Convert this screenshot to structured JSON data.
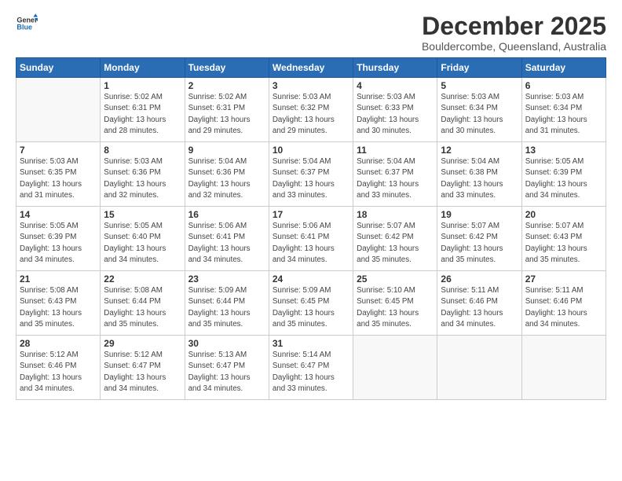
{
  "header": {
    "logo_line1": "General",
    "logo_line2": "Blue",
    "month_title": "December 2025",
    "location": "Bouldercombe, Queensland, Australia"
  },
  "days_of_week": [
    "Sunday",
    "Monday",
    "Tuesday",
    "Wednesday",
    "Thursday",
    "Friday",
    "Saturday"
  ],
  "weeks": [
    [
      {
        "day": "",
        "detail": ""
      },
      {
        "day": "1",
        "detail": "Sunrise: 5:02 AM\nSunset: 6:31 PM\nDaylight: 13 hours\nand 28 minutes."
      },
      {
        "day": "2",
        "detail": "Sunrise: 5:02 AM\nSunset: 6:31 PM\nDaylight: 13 hours\nand 29 minutes."
      },
      {
        "day": "3",
        "detail": "Sunrise: 5:03 AM\nSunset: 6:32 PM\nDaylight: 13 hours\nand 29 minutes."
      },
      {
        "day": "4",
        "detail": "Sunrise: 5:03 AM\nSunset: 6:33 PM\nDaylight: 13 hours\nand 30 minutes."
      },
      {
        "day": "5",
        "detail": "Sunrise: 5:03 AM\nSunset: 6:34 PM\nDaylight: 13 hours\nand 30 minutes."
      },
      {
        "day": "6",
        "detail": "Sunrise: 5:03 AM\nSunset: 6:34 PM\nDaylight: 13 hours\nand 31 minutes."
      }
    ],
    [
      {
        "day": "7",
        "detail": "Sunrise: 5:03 AM\nSunset: 6:35 PM\nDaylight: 13 hours\nand 31 minutes."
      },
      {
        "day": "8",
        "detail": "Sunrise: 5:03 AM\nSunset: 6:36 PM\nDaylight: 13 hours\nand 32 minutes."
      },
      {
        "day": "9",
        "detail": "Sunrise: 5:04 AM\nSunset: 6:36 PM\nDaylight: 13 hours\nand 32 minutes."
      },
      {
        "day": "10",
        "detail": "Sunrise: 5:04 AM\nSunset: 6:37 PM\nDaylight: 13 hours\nand 33 minutes."
      },
      {
        "day": "11",
        "detail": "Sunrise: 5:04 AM\nSunset: 6:37 PM\nDaylight: 13 hours\nand 33 minutes."
      },
      {
        "day": "12",
        "detail": "Sunrise: 5:04 AM\nSunset: 6:38 PM\nDaylight: 13 hours\nand 33 minutes."
      },
      {
        "day": "13",
        "detail": "Sunrise: 5:05 AM\nSunset: 6:39 PM\nDaylight: 13 hours\nand 34 minutes."
      }
    ],
    [
      {
        "day": "14",
        "detail": "Sunrise: 5:05 AM\nSunset: 6:39 PM\nDaylight: 13 hours\nand 34 minutes."
      },
      {
        "day": "15",
        "detail": "Sunrise: 5:05 AM\nSunset: 6:40 PM\nDaylight: 13 hours\nand 34 minutes."
      },
      {
        "day": "16",
        "detail": "Sunrise: 5:06 AM\nSunset: 6:41 PM\nDaylight: 13 hours\nand 34 minutes."
      },
      {
        "day": "17",
        "detail": "Sunrise: 5:06 AM\nSunset: 6:41 PM\nDaylight: 13 hours\nand 34 minutes."
      },
      {
        "day": "18",
        "detail": "Sunrise: 5:07 AM\nSunset: 6:42 PM\nDaylight: 13 hours\nand 35 minutes."
      },
      {
        "day": "19",
        "detail": "Sunrise: 5:07 AM\nSunset: 6:42 PM\nDaylight: 13 hours\nand 35 minutes."
      },
      {
        "day": "20",
        "detail": "Sunrise: 5:07 AM\nSunset: 6:43 PM\nDaylight: 13 hours\nand 35 minutes."
      }
    ],
    [
      {
        "day": "21",
        "detail": "Sunrise: 5:08 AM\nSunset: 6:43 PM\nDaylight: 13 hours\nand 35 minutes."
      },
      {
        "day": "22",
        "detail": "Sunrise: 5:08 AM\nSunset: 6:44 PM\nDaylight: 13 hours\nand 35 minutes."
      },
      {
        "day": "23",
        "detail": "Sunrise: 5:09 AM\nSunset: 6:44 PM\nDaylight: 13 hours\nand 35 minutes."
      },
      {
        "day": "24",
        "detail": "Sunrise: 5:09 AM\nSunset: 6:45 PM\nDaylight: 13 hours\nand 35 minutes."
      },
      {
        "day": "25",
        "detail": "Sunrise: 5:10 AM\nSunset: 6:45 PM\nDaylight: 13 hours\nand 35 minutes."
      },
      {
        "day": "26",
        "detail": "Sunrise: 5:11 AM\nSunset: 6:46 PM\nDaylight: 13 hours\nand 34 minutes."
      },
      {
        "day": "27",
        "detail": "Sunrise: 5:11 AM\nSunset: 6:46 PM\nDaylight: 13 hours\nand 34 minutes."
      }
    ],
    [
      {
        "day": "28",
        "detail": "Sunrise: 5:12 AM\nSunset: 6:46 PM\nDaylight: 13 hours\nand 34 minutes."
      },
      {
        "day": "29",
        "detail": "Sunrise: 5:12 AM\nSunset: 6:47 PM\nDaylight: 13 hours\nand 34 minutes."
      },
      {
        "day": "30",
        "detail": "Sunrise: 5:13 AM\nSunset: 6:47 PM\nDaylight: 13 hours\nand 34 minutes."
      },
      {
        "day": "31",
        "detail": "Sunrise: 5:14 AM\nSunset: 6:47 PM\nDaylight: 13 hours\nand 33 minutes."
      },
      {
        "day": "",
        "detail": ""
      },
      {
        "day": "",
        "detail": ""
      },
      {
        "day": "",
        "detail": ""
      }
    ]
  ]
}
